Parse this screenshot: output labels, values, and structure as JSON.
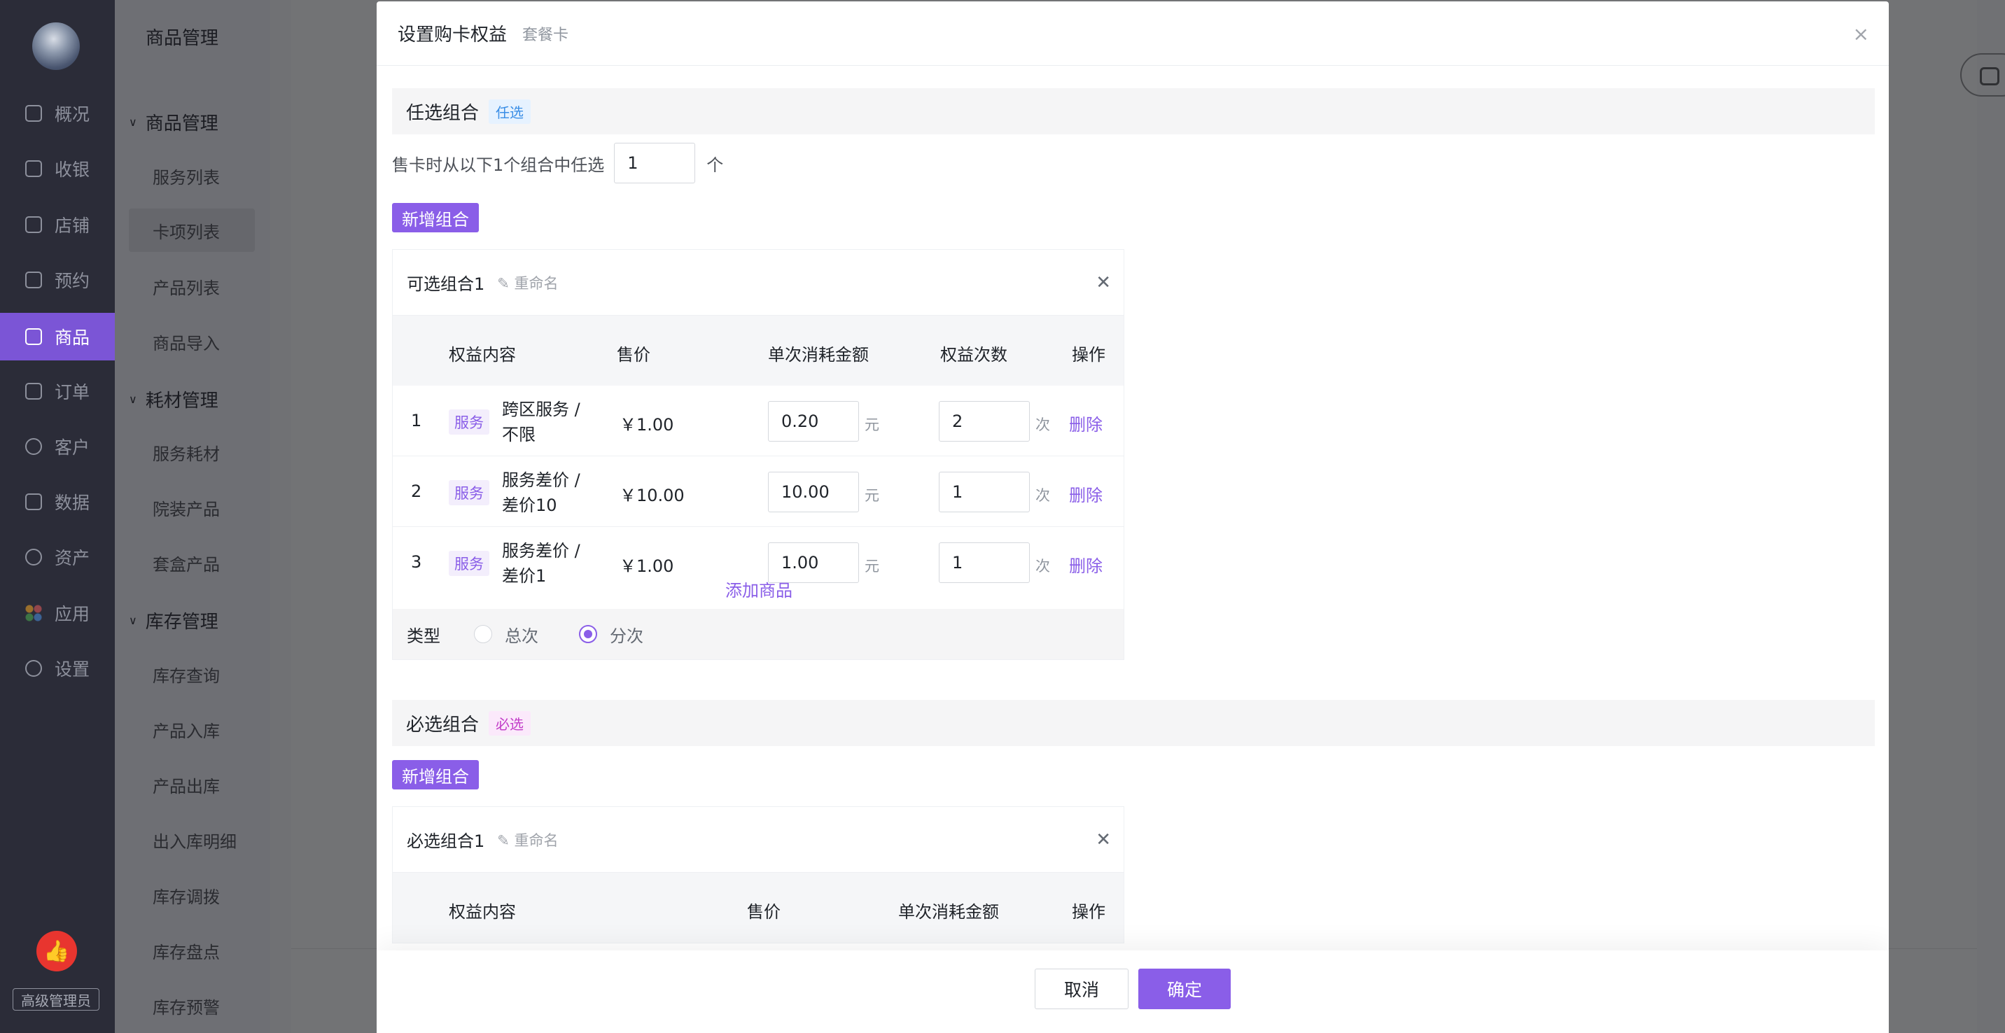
{
  "rail": {
    "items": [
      {
        "label": "概况",
        "icon": "monitor-icon"
      },
      {
        "label": "收银",
        "icon": "cashier-icon"
      },
      {
        "label": "店铺",
        "icon": "store-icon"
      },
      {
        "label": "预约",
        "icon": "calendar-icon"
      },
      {
        "label": "商品",
        "icon": "bag-icon"
      },
      {
        "label": "订单",
        "icon": "order-icon"
      },
      {
        "label": "客户",
        "icon": "user-icon"
      },
      {
        "label": "数据",
        "icon": "chart-icon"
      },
      {
        "label": "资产",
        "icon": "asset-icon"
      },
      {
        "label": "应用",
        "icon": "apps-icon"
      },
      {
        "label": "设置",
        "icon": "gear-icon"
      }
    ],
    "active": "商品",
    "like_glyph": "👍",
    "role": "高级管理员"
  },
  "submenu": {
    "title": "商品管理",
    "groups": [
      {
        "label": "商品管理",
        "items": [
          "服务列表",
          "卡项列表",
          "产品列表",
          "商品导入"
        ]
      },
      {
        "label": "耗材管理",
        "items": [
          "服务耗材",
          "院装产品",
          "套盒产品"
        ]
      },
      {
        "label": "库存管理",
        "items": [
          "库存查询",
          "产品入库",
          "产品出库",
          "出入库明细",
          "库存调拨",
          "库存盘点",
          "库存预警"
        ]
      }
    ],
    "active_item": "卡项列表"
  },
  "modal": {
    "title": "设置购卡权益",
    "subtitle": "套餐卡",
    "close_glyph": "×",
    "optional": {
      "title": "任选组合",
      "tag": "任选",
      "pick_prefix": "售卡时从以下1个组合中任选",
      "pick_value": "1",
      "pick_suffix": "个",
      "add_button": "新增组合",
      "combo": {
        "name": "可选组合1",
        "rename": "✎ 重命名",
        "columns": [
          "权益内容",
          "售价",
          "单次消耗金额",
          "权益次数",
          "操作"
        ],
        "rows": [
          {
            "idx": "1",
            "tag": "服务",
            "name": "跨区服务 / 不限",
            "price": "￥1.00",
            "amount": "0.20",
            "amount_unit": "元",
            "count": "2",
            "count_unit": "次",
            "action": "删除"
          },
          {
            "idx": "2",
            "tag": "服务",
            "name": "服务差价 / 差价10",
            "price": "￥10.00",
            "amount": "10.00",
            "amount_unit": "元",
            "count": "1",
            "count_unit": "次",
            "action": "删除"
          },
          {
            "idx": "3",
            "tag": "服务",
            "name": "服务差价 / 差价1",
            "price": "￥1.00",
            "amount": "1.00",
            "amount_unit": "元",
            "count": "1",
            "count_unit": "次",
            "action": "删除"
          }
        ],
        "add_goods": "添加商品",
        "type_label": "类型",
        "type_options": [
          "总次",
          "分次"
        ],
        "type_selected": "分次"
      }
    },
    "required": {
      "title": "必选组合",
      "tag": "必选",
      "add_button": "新增组合",
      "combo": {
        "name": "必选组合1",
        "rename": "✎ 重命名",
        "columns": [
          "权益内容",
          "售价",
          "单次消耗金额",
          "操作"
        ]
      }
    },
    "footer": {
      "cancel": "取消",
      "ok": "确定"
    }
  }
}
